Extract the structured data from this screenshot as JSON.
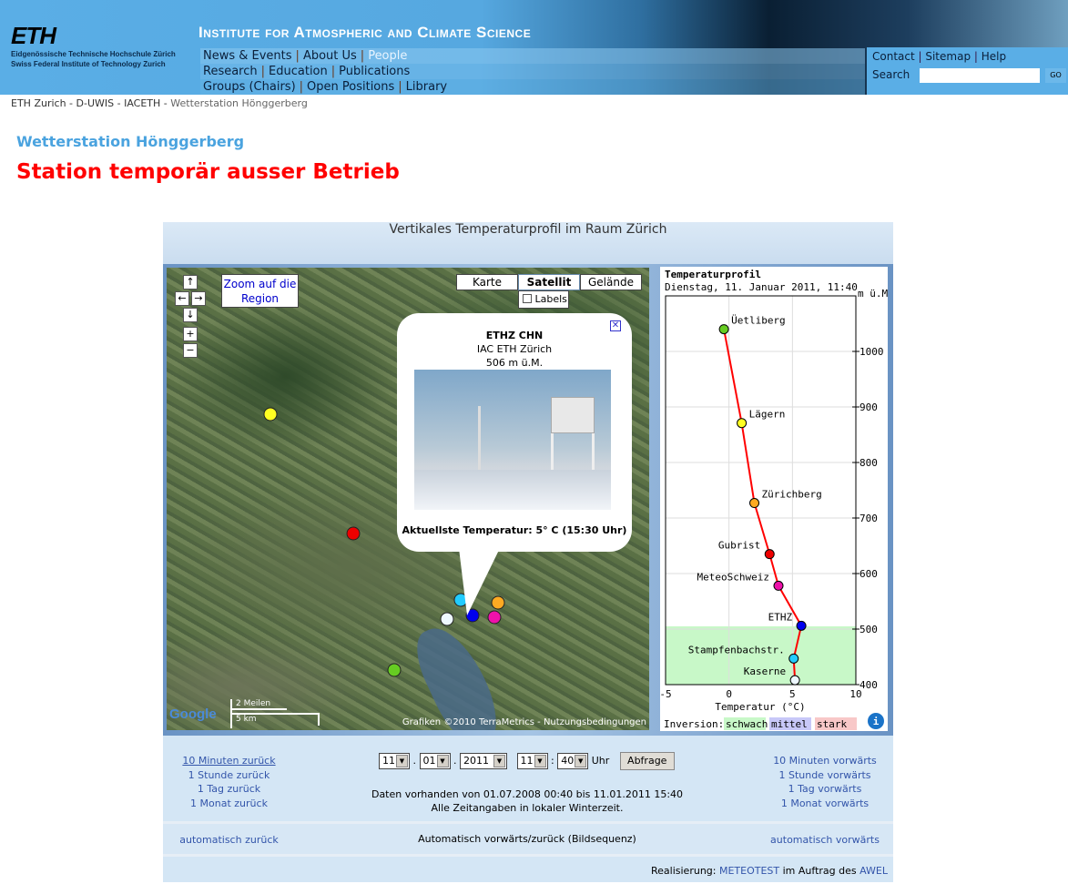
{
  "header": {
    "logo": "ETH",
    "logo_sub1": "Eidgenössische Technische Hochschule Zürich",
    "logo_sub2": "Swiss Federal Institute of Technology Zurich",
    "institute": "Institute for Atmospheric and Climate Science",
    "nav_rows": [
      [
        "News & Events",
        "About Us",
        "People"
      ],
      [
        "Research",
        "Education",
        "Publications"
      ],
      [
        "Groups (Chairs)",
        "Open Positions",
        "Library"
      ]
    ],
    "util_links": [
      "Contact",
      "Sitemap",
      "Help"
    ],
    "search_label": "Search",
    "search_value": "",
    "go_label": "GO"
  },
  "breadcrumb": [
    "ETH Zurich",
    "D-UWIS",
    "IACETH",
    "Wetterstation Hönggerberg"
  ],
  "page_title": "Wetterstation Hönggerberg",
  "status": "Station temporär ausser Betrieb",
  "panel": {
    "title": "Vertikales Temperaturprofil im Raum Zürich",
    "map": {
      "zoom_region": "Zoom auf die Region",
      "types": [
        "Karte",
        "Satellit",
        "Gelände"
      ],
      "selected_type": "Satellit",
      "labels_checkbox": "Labels",
      "labels_checked": false,
      "scale_top": "2 Meilen",
      "scale_bottom": "5 km",
      "google": "Google",
      "copyright": "Grafiken ©2010 TerraMetrics - Nutzungsbedingungen",
      "popup": {
        "name": "ETHZ CHN",
        "org": "IAC ETH Zürich",
        "altitude": "506 m ü.M.",
        "temperature": "Aktuellste Temperatur: 5° C (15:30 Uhr)"
      }
    },
    "controls": {
      "back": [
        "10 Minuten zurück",
        "1 Stunde zurück",
        "1 Tag zurück",
        "1 Monat zurück"
      ],
      "forward": [
        "10 Minuten vorwärts",
        "1 Stunde vorwärts",
        "1 Tag vorwärts",
        "1 Monat vorwärts"
      ],
      "day": "11",
      "month": "01",
      "year": "2011",
      "hour": "11",
      "minute": "40",
      "uhr": "Uhr",
      "query": "Abfrage",
      "range": "Daten vorhanden von 01.07.2008 00:40 bis 11.01.2011 15:40",
      "timezone": "Alle Zeitangaben in lokaler Winterzeit.",
      "auto_back": "automatisch zurück",
      "auto_label": "Automatisch vorwärts/zurück (Bildsequenz)",
      "auto_forward": "automatisch vorwärts"
    },
    "footer": {
      "prefix": "Realisierung:",
      "meteotest": "METEOTEST",
      "middle": "im Auftrag des",
      "awel": "AWEL"
    }
  },
  "chart_data": {
    "type": "line",
    "title": "Temperaturprofil",
    "subtitle": "Dienstag, 11. Januar 2011, 11:40",
    "xlabel": "Temperatur (°C)",
    "ylabel": "m ü.M",
    "xlim": [
      -5,
      10
    ],
    "ylim": [
      400,
      1100
    ],
    "xticks": [
      -5,
      0,
      5,
      10
    ],
    "yticks": [
      400,
      500,
      600,
      700,
      800,
      900,
      1000
    ],
    "grid": true,
    "points": [
      {
        "name": "Üetliberg",
        "t": -0.4,
        "alt": 1040,
        "color": "#66cc22"
      },
      {
        "name": "Lägern",
        "t": 1.0,
        "alt": 871,
        "color": "#ffff22"
      },
      {
        "name": "Zürichberg",
        "t": 2.0,
        "alt": 727,
        "color": "#ffaa22"
      },
      {
        "name": "Gubrist",
        "t": 3.2,
        "alt": 635,
        "color": "#ee0000"
      },
      {
        "name": "MeteoSchweiz",
        "t": 3.9,
        "alt": 578,
        "color": "#ee11aa"
      },
      {
        "name": "ETHZ",
        "t": 5.7,
        "alt": 506,
        "color": "#0000ee"
      },
      {
        "name": "Stampfenbachstr.",
        "t": 5.1,
        "alt": 447,
        "color": "#22ccff"
      },
      {
        "name": "Kaserne",
        "t": 5.2,
        "alt": 408,
        "color": "#eef8ff"
      }
    ],
    "line_color": "#ff0000",
    "inversion_band": [
      400,
      505
    ],
    "inversion_level": "schwach",
    "legend": {
      "label": "Inversion:",
      "items": [
        {
          "name": "schwach",
          "color": "#c8f8c8"
        },
        {
          "name": "mittel",
          "color": "#c8c8f8"
        },
        {
          "name": "stark",
          "color": "#f8c8c8"
        }
      ]
    }
  }
}
